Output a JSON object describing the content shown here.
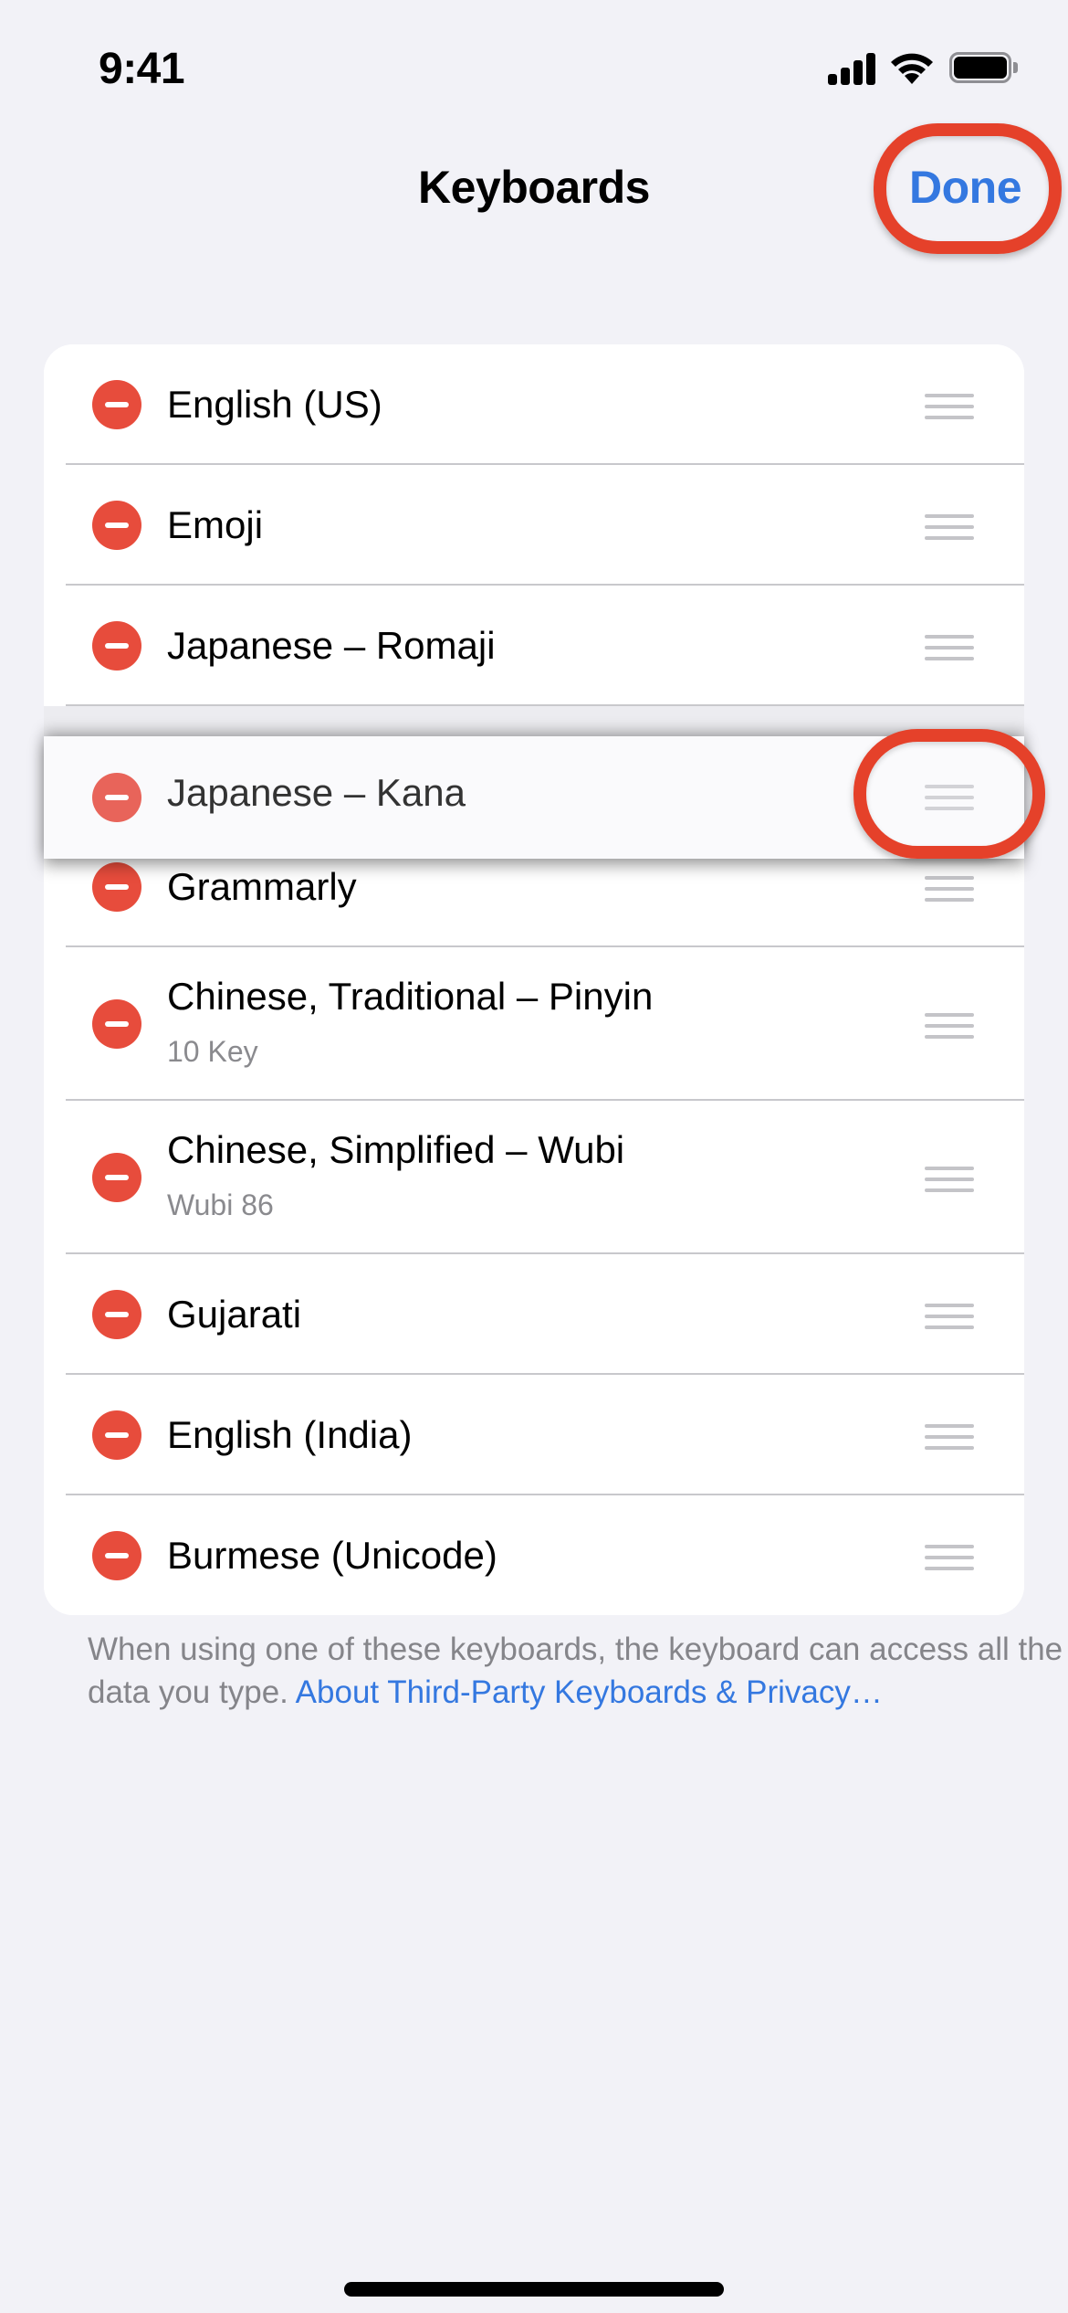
{
  "status_bar": {
    "time": "9:41",
    "icons": [
      "cellular-signal-icon",
      "wifi-icon",
      "battery-icon"
    ]
  },
  "nav": {
    "title": "Keyboards",
    "done_label": "Done"
  },
  "keyboards": [
    {
      "title": "English (US)",
      "subtitle": ""
    },
    {
      "title": "Emoji",
      "subtitle": ""
    },
    {
      "title": "Japanese – Romaji",
      "subtitle": ""
    },
    {
      "title": "Grammarly",
      "subtitle": ""
    },
    {
      "title": "Chinese, Traditional – Pinyin",
      "subtitle": "10 Key"
    },
    {
      "title": "Chinese, Simplified – Wubi",
      "subtitle": "Wubi 86"
    },
    {
      "title": "Gujarati",
      "subtitle": ""
    },
    {
      "title": "English (India)",
      "subtitle": ""
    },
    {
      "title": "Burmese (Unicode)",
      "subtitle": ""
    }
  ],
  "dragging": {
    "title": "Japanese – Kana"
  },
  "footer": {
    "text": "When using one of these keyboards, the keyboard can access all the data you type. ",
    "link": "About Third-Party Keyboards & Privacy…"
  },
  "colors": {
    "accent": "#3478e0",
    "delete": "#e74c3c",
    "annotation": "#e5412a",
    "background": "#f2f2f7"
  }
}
